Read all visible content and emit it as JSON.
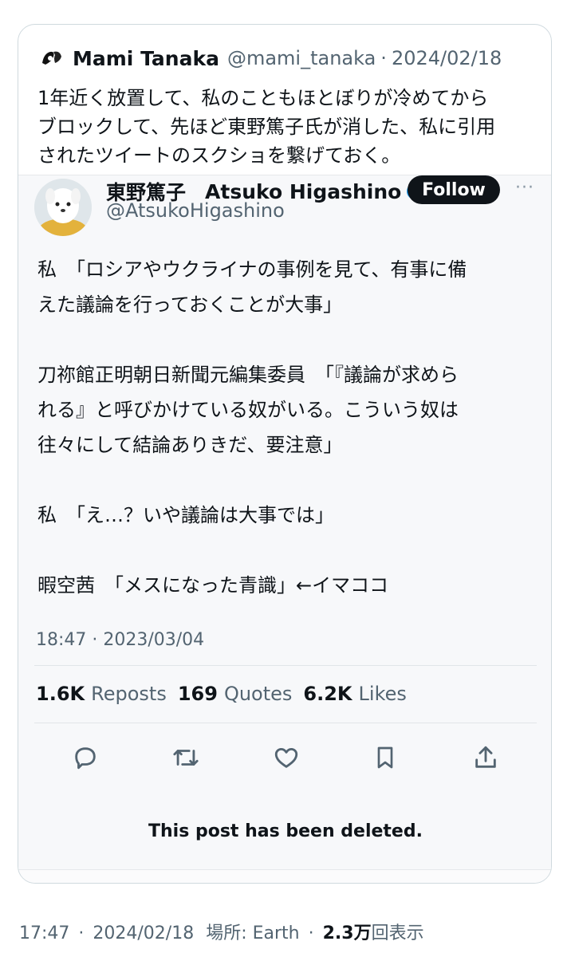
{
  "quote": {
    "name": "Mami Tanaka",
    "handle": "@mami_tanaka",
    "sep": "·",
    "date": "2024/02/18",
    "text": "1年近く放置して、私のこともほとぼりが冷めてから\nブロックして、先ほど東野篤子氏が消した、私に引用\nされたツイートのスクショを繋げておく。"
  },
  "embedded": {
    "name_jp": "東野篤子",
    "name_en": "Atsuko Higashino",
    "handle": "@AtsukoHigashino",
    "follow_label": "Follow",
    "more_label": "···",
    "body": "私　「ロシアやウクライナの事例を見て、有事に備\nえた議論を行っておくことが大事」\n\n刀祢館正明朝日新聞元編集委員　「『議論が求めら\nれる』と呼びかけている奴がいる。こういう奴は\n往々にして結論ありきだ、要注意」\n\n私　「え…？いや議論は大事では」\n\n暇空茜　「メスになった青識」←イマココ",
    "timestamp": "18:47 · 2023/03/04",
    "stats": {
      "reposts_count": "1.6K",
      "reposts_label": "Reposts",
      "quotes_count": "169",
      "quotes_label": "Quotes",
      "likes_count": "6.2K",
      "likes_label": "Likes"
    },
    "actions": [
      "reply-icon",
      "repost-icon",
      "like-icon",
      "bookmark-icon",
      "share-icon"
    ],
    "deleted_notice": "This post has been deleted."
  },
  "footer": {
    "time": "17:47",
    "sep": "·",
    "date": "2024/02/18",
    "location": "場所: Earth",
    "sep2": "·",
    "views_count": "2.3万",
    "views_label": "回表示"
  },
  "colors": {
    "text": "#0f1419",
    "muted": "#536471",
    "border": "#cfd9de",
    "verified": "#1d9bf0",
    "follow_bg": "#0f1419"
  }
}
